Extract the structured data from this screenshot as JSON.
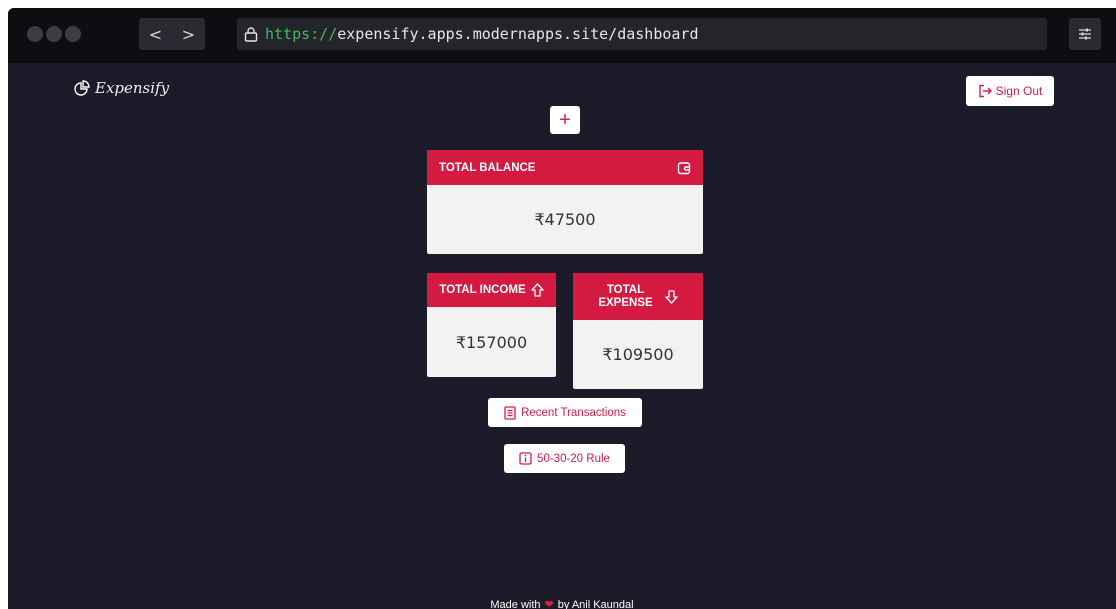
{
  "browser": {
    "back_glyph": "<",
    "forward_glyph": ">",
    "url_scheme": "https://",
    "url_rest": "expensify.apps.modernapps.site/dashboard"
  },
  "header": {
    "logo_text": "Expensify",
    "signout_label": "Sign Out",
    "add_label": "+"
  },
  "cards": {
    "balance": {
      "title": "TOTAL BALANCE",
      "value": "₹47500"
    },
    "income": {
      "title": "TOTAL INCOME",
      "value": "₹157000"
    },
    "expense": {
      "title_line1": "TOTAL",
      "title_line2": "EXPENSE",
      "value": "₹109500"
    }
  },
  "links": {
    "recent": "Recent Transactions",
    "rule": "50-30-20 Rule"
  },
  "footer": {
    "prefix": "Made with",
    "suffix": "by Anil Kaundal"
  },
  "icons": {
    "logo": "pie-chart-icon",
    "signout": "sign-out-icon",
    "balance": "wallet-icon",
    "income": "arrow-up-icon",
    "expense": "arrow-down-icon",
    "recent": "receipt-icon",
    "rule": "info-icon",
    "heart": "heart-icon"
  },
  "colors": {
    "accent": "#d41a40",
    "background": "#1b1b29",
    "url_scheme": "#3dbb5b"
  }
}
